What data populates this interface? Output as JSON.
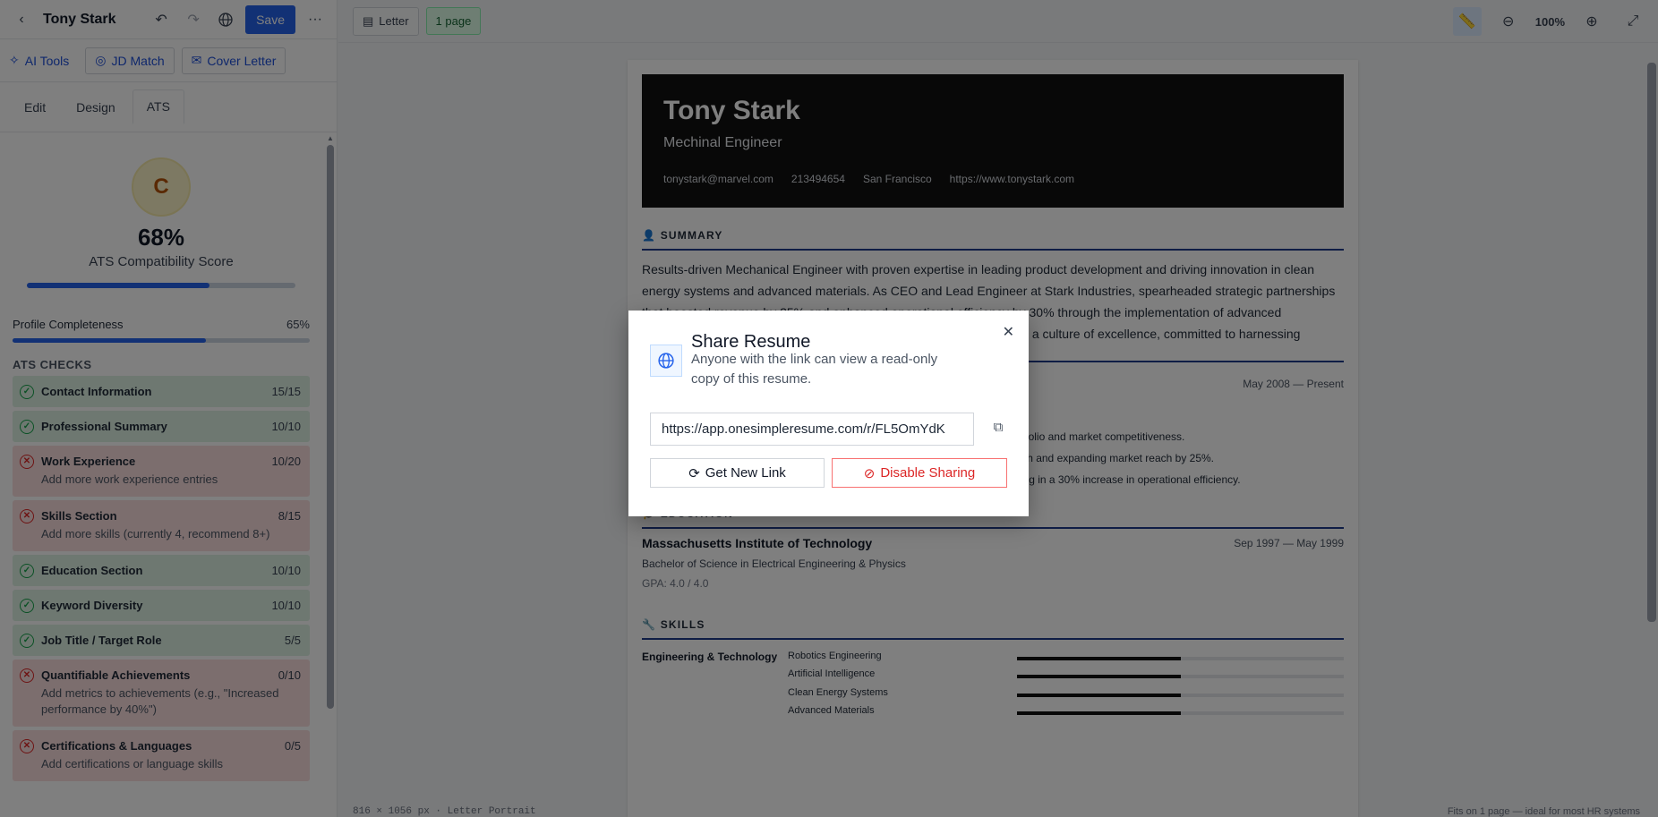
{
  "app": {
    "title": "Tony Stark",
    "save_label": "Save"
  },
  "tools": {
    "ai": "AI Tools",
    "jd": "JD Match",
    "cover": "Cover Letter"
  },
  "tabs": [
    "Edit",
    "Design",
    "ATS"
  ],
  "ats": {
    "grade": "C",
    "score": "68%",
    "score_label": "ATS Compatibility Score",
    "score_fill_pct": 68,
    "profile_label": "Profile Completeness",
    "profile_value": "65%",
    "profile_fill_pct": 65,
    "checks_heading": "ATS CHECKS",
    "checks": [
      {
        "title": "Contact Information",
        "score": "15/15",
        "status": "pass",
        "desc": ""
      },
      {
        "title": "Professional Summary",
        "score": "10/10",
        "status": "pass",
        "desc": ""
      },
      {
        "title": "Work Experience",
        "score": "10/20",
        "status": "fail",
        "desc": "Add more work experience entries"
      },
      {
        "title": "Skills Section",
        "score": "8/15",
        "status": "fail",
        "desc": "Add more skills (currently 4, recommend 8+)"
      },
      {
        "title": "Education Section",
        "score": "10/10",
        "status": "pass",
        "desc": ""
      },
      {
        "title": "Keyword Diversity",
        "score": "10/10",
        "status": "pass",
        "desc": ""
      },
      {
        "title": "Job Title / Target Role",
        "score": "5/5",
        "status": "pass",
        "desc": ""
      },
      {
        "title": "Quantifiable Achievements",
        "score": "0/10",
        "status": "fail",
        "desc": "Add metrics to achievements (e.g., \"Increased performance by 40%\")"
      },
      {
        "title": "Certifications & Languages",
        "score": "0/5",
        "status": "fail",
        "desc": "Add certifications or language skills"
      }
    ]
  },
  "toolbar": {
    "paper": "Letter",
    "pages": "1 page",
    "zoom": "100%"
  },
  "status": {
    "left": "816 × 1056 px · Letter Portrait",
    "right": "Fits on 1 page — ideal for most HR systems"
  },
  "resume": {
    "name": "Tony Stark",
    "role": "Mechinal Engineer",
    "contacts": [
      "tonystark@marvel.com",
      "213494654",
      "San Francisco",
      "https://www.tonystark.com"
    ],
    "summary_title": "SUMMARY",
    "summary_lines": [
      "Results-driven Mechanical Engineer with proven expertise in leading product development and driving innovation in clean",
      "energy systems and advanced materials. As CEO and Lead Engineer at Stark Industries, spearheaded strategic partnerships",
      "that boosted revenue by 25% and enhanced operational efficiency by 30% through the implementation of advanced",
      "technologies. Adept at managing cross-functional teams and fostering a culture of excellence, committed to harnessing technology for"
    ],
    "exp_date": "May 2008 — Present",
    "bullets": [
      "Directed the development of innovative products, strengthening company portfolio and market competitiveness.",
      "Established strategic partnerships with industry leaders, driving revenue growth and expanding market reach by 25%.",
      "Led cross-functional teams in implementing cutting-edge technologies, resulting in a 30% increase in operational efficiency."
    ],
    "education_title": "EDUCATION",
    "school": "Massachusetts Institute of Technology",
    "edu_date": "Sep 1997 — May 1999",
    "degree": "Bachelor of Science in Electrical Engineering & Physics",
    "gpa": "GPA: 4.0 / 4.0",
    "skills_title": "SKILLS",
    "skill_category": "Engineering & Technology",
    "skills": [
      {
        "name": "Robotics Engineering",
        "level_pct": 50
      },
      {
        "name": "Artificial Intelligence",
        "level_pct": 50
      },
      {
        "name": "Clean Energy Systems",
        "level_pct": 50
      },
      {
        "name": "Advanced Materials",
        "level_pct": 50
      }
    ]
  },
  "modal": {
    "title": "Share Resume",
    "desc": "Anyone with the link can view a read-only copy of this resume.",
    "link": "https://app.onesimpleresume.com/r/FL5OmYdK",
    "new_link": "Get New Link",
    "disable": "Disable Sharing"
  },
  "colors": {
    "accent": "#2563eb",
    "pass_bg": "#dcf0e2",
    "fail_bg": "#f8dcdc",
    "danger": "#dc2626"
  }
}
